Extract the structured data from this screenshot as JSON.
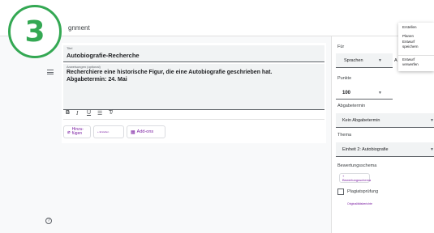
{
  "header": {
    "title_visible": "gnment"
  },
  "step_badge": "3",
  "title_field": {
    "label": "Titel",
    "value": "Autobiografie-Recherche"
  },
  "description_field": {
    "label": "Anweisungen (optional)",
    "line1": "Recherchiere eine historische Figur, die eine Autobiografie geschrieben hat.",
    "line2": "Abgabetermin: 24. Mai"
  },
  "format_toolbar": {
    "bold": "B",
    "italic": "I",
    "underline": "U",
    "list": "☰",
    "clear": "T̸"
  },
  "attach": {
    "add_label": "Hinzu-\nfügen",
    "create_label": "+ Erstellen",
    "addons_label": "Add-ons"
  },
  "help_icon": "?",
  "sidebar": {
    "for_label": "Für",
    "for_value": "Sprachen",
    "for_value2": "A",
    "points_label": "Punkte",
    "points_value": "100",
    "due_label": "Abgabetermin",
    "due_value": "Kein Abgabetermin",
    "topic_label": "Thema",
    "topic_value": "Einheit 2: Autobiografie",
    "rubric_label": "Bewertungsschema",
    "rubric_button": "+ Bewertungsschema",
    "plagiarism_label": "Plagiatsprüfung",
    "plagiarism_sub": "Originalitätsberichte"
  },
  "menu": {
    "item1": "Erstellen",
    "item2": "Planen",
    "item3a": "Entwurf",
    "item3b": "speichern",
    "item4a": "Entwurf",
    "item4b": "verwerfen"
  }
}
